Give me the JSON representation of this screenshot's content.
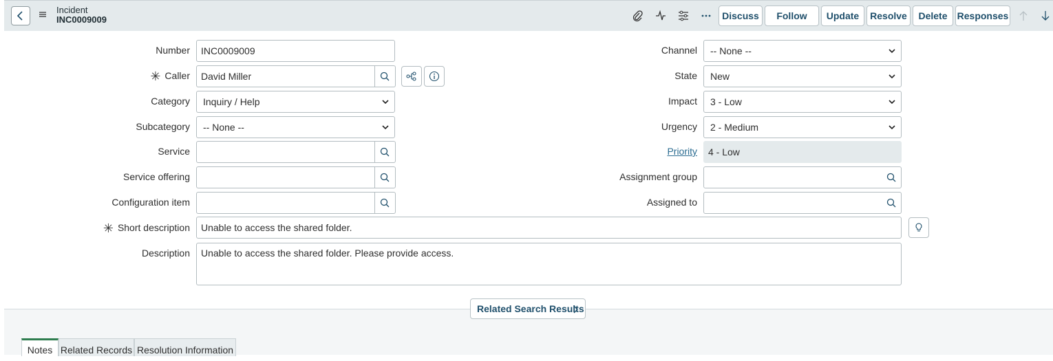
{
  "header": {
    "record_type": "Incident",
    "record_number": "INC0009009",
    "buttons": {
      "discuss": "Discuss",
      "follow": "Follow",
      "update": "Update",
      "resolve": "Resolve",
      "delete": "Delete",
      "responses": "Responses"
    },
    "icons": [
      "back-icon",
      "menu-icon",
      "paperclip-icon",
      "activity-icon",
      "settings-sliders-icon",
      "more-icon",
      "arrow-up-icon",
      "arrow-down-icon"
    ]
  },
  "form": {
    "left": {
      "number": {
        "label": "Number",
        "value": "INC0009009"
      },
      "caller": {
        "label": "Caller",
        "value": "David Miller",
        "required_mark": "✳"
      },
      "category": {
        "label": "Category",
        "value": "Inquiry / Help"
      },
      "subcategory": {
        "label": "Subcategory",
        "value": "-- None --"
      },
      "service": {
        "label": "Service",
        "value": ""
      },
      "service_offering": {
        "label": "Service offering",
        "value": ""
      },
      "configuration_item": {
        "label": "Configuration item",
        "value": ""
      }
    },
    "right": {
      "channel": {
        "label": "Channel",
        "value": "-- None --"
      },
      "state": {
        "label": "State",
        "value": "New"
      },
      "impact": {
        "label": "Impact",
        "value": "3 - Low"
      },
      "urgency": {
        "label": "Urgency",
        "value": "2 - Medium"
      },
      "priority": {
        "label": "Priority",
        "value": "4 - Low"
      },
      "assignment_group": {
        "label": "Assignment group",
        "value": ""
      },
      "assigned_to": {
        "label": "Assigned to",
        "value": ""
      }
    },
    "short_description": {
      "label": "Short description",
      "value": "Unable to access the shared folder.",
      "required_mark": "✳"
    },
    "description": {
      "label": "Description",
      "value": "Unable to access the shared folder. Please provide access."
    }
  },
  "related_search": {
    "label": "Related Search Results"
  },
  "tabs": [
    {
      "label": "Notes",
      "active": true
    },
    {
      "label": "Related Records",
      "active": false
    },
    {
      "label": "Resolution Information",
      "active": false
    }
  ],
  "colors": {
    "header_bg": "#e4eaec",
    "accent": "#1f4f6b",
    "active_tab": "#2e7d4f",
    "link": "#2b6c91"
  }
}
